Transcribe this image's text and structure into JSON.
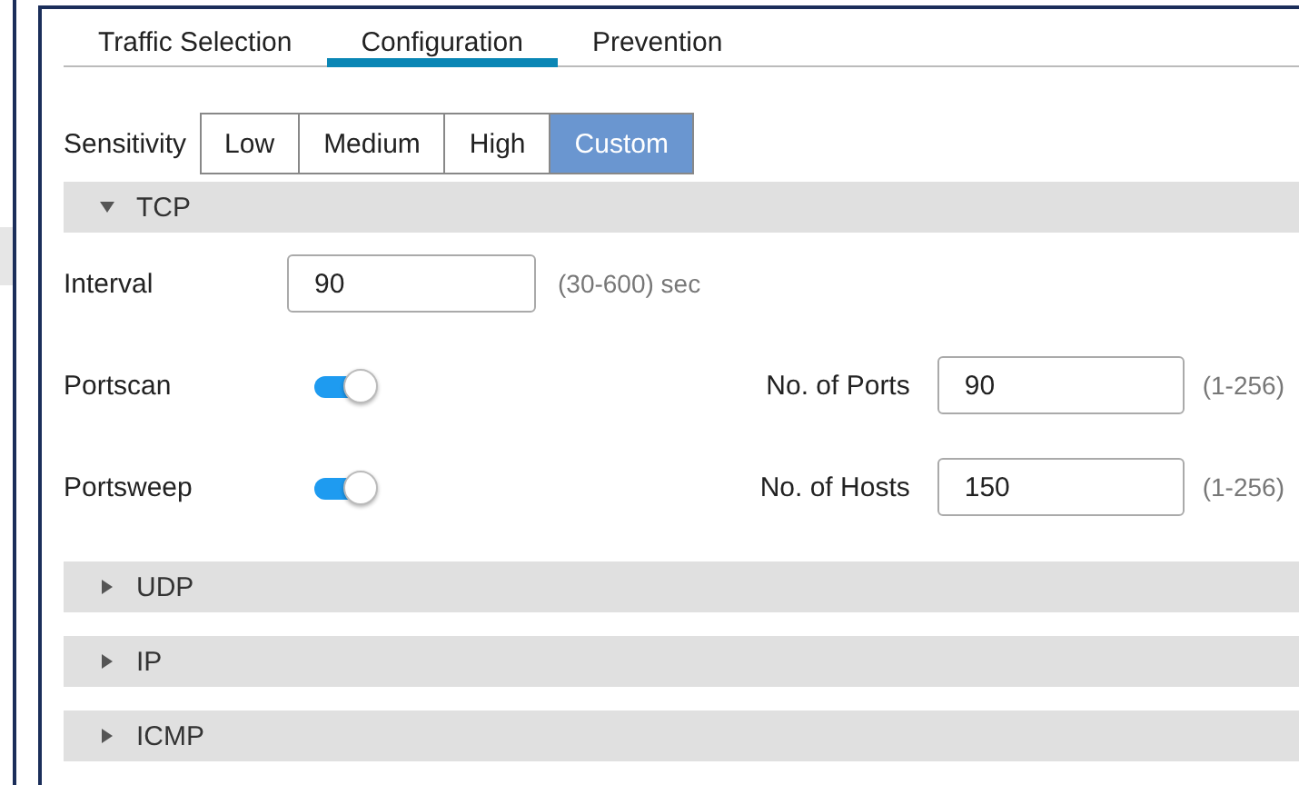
{
  "tabs": [
    {
      "label": "Traffic Selection",
      "selected": false
    },
    {
      "label": "Configuration",
      "selected": true
    },
    {
      "label": "Prevention",
      "selected": false
    }
  ],
  "sensitivity": {
    "label": "Sensitivity",
    "options": [
      {
        "label": "Low",
        "selected": false
      },
      {
        "label": "Medium",
        "selected": false
      },
      {
        "label": "High",
        "selected": false
      },
      {
        "label": "Custom",
        "selected": true
      }
    ]
  },
  "sections": [
    {
      "title": "TCP",
      "expanded": true,
      "interval": {
        "label": "Interval",
        "value": "90",
        "hint": "(30-600) sec"
      },
      "rows": [
        {
          "label": "Portscan",
          "on": true,
          "field_label": "No. of Ports",
          "value": "90",
          "hint": "(1-256)"
        },
        {
          "label": "Portsweep",
          "on": true,
          "field_label": "No. of Hosts",
          "value": "150",
          "hint": "(1-256)"
        }
      ]
    },
    {
      "title": "UDP",
      "expanded": false
    },
    {
      "title": "IP",
      "expanded": false
    },
    {
      "title": "ICMP",
      "expanded": false
    }
  ]
}
